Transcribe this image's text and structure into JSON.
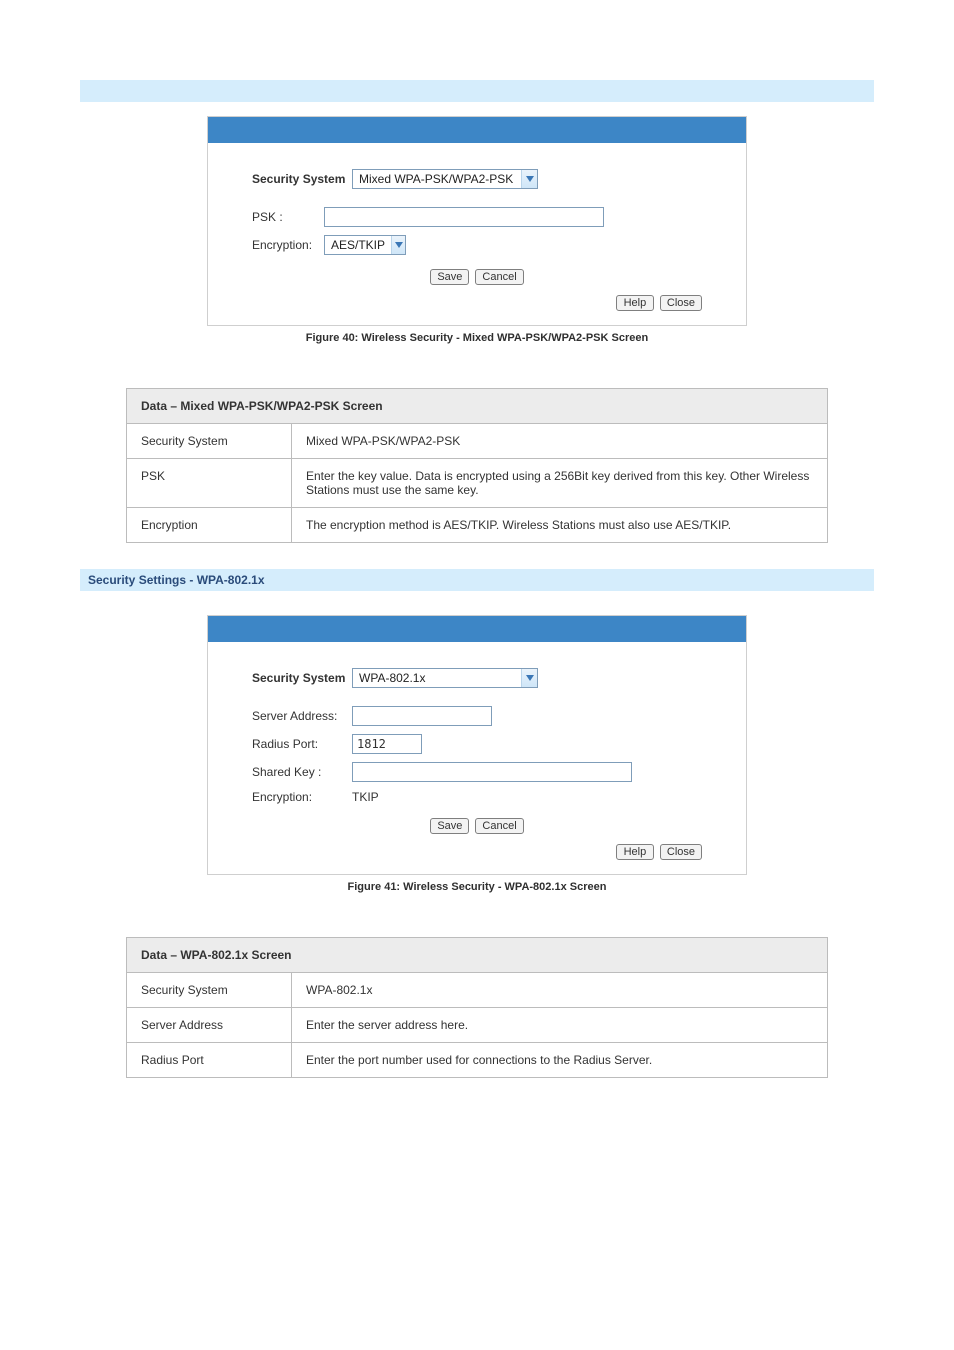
{
  "bars": {},
  "figure1": {
    "label_security": "Security System",
    "sec_value": "Mixed WPA-PSK/WPA2-PSK",
    "label_psk": "PSK :",
    "label_enc": "Encryption:",
    "enc_value": "AES/TKIP",
    "btn_save": "Save",
    "btn_cancel": "Cancel",
    "btn_help": "Help",
    "btn_close": "Close",
    "caption": "Figure 40: Wireless Security - Mixed WPA-PSK/WPA2-PSK Screen"
  },
  "table1": {
    "header": "Data – Mixed WPA-PSK/WPA2-PSK Screen",
    "rows": [
      {
        "k": "Security System",
        "v": "Mixed WPA-PSK/WPA2-PSK"
      },
      {
        "k": "PSK",
        "v": "Enter the key value. Data is encrypted using a 256Bit key derived from this key. Other Wireless Stations must use the same key."
      },
      {
        "k": "Encryption",
        "v": "The encryption method is AES/TKIP. Wireless Stations must also use AES/TKIP."
      }
    ]
  },
  "section2_title": "Security Settings - WPA-802.1x",
  "figure2": {
    "label_security": "Security System",
    "sec_value": "WPA-802.1x",
    "label_server": "Server Address:",
    "label_radius": "Radius Port:",
    "radius_value": "1812",
    "label_shared": "Shared Key :",
    "label_enc": "Encryption:",
    "enc_value": "TKIP",
    "btn_save": "Save",
    "btn_cancel": "Cancel",
    "btn_help": "Help",
    "btn_close": "Close",
    "caption": "Figure 41: Wireless Security - WPA-802.1x Screen"
  },
  "table2": {
    "header": "Data – WPA-802.1x Screen",
    "rows": [
      {
        "k": "Security System",
        "v": "WPA-802.1x"
      },
      {
        "k": "Server Address",
        "v": "Enter the server address here."
      },
      {
        "k": "Radius Port",
        "v": "Enter the port number used for connections to the Radius Server."
      }
    ]
  }
}
